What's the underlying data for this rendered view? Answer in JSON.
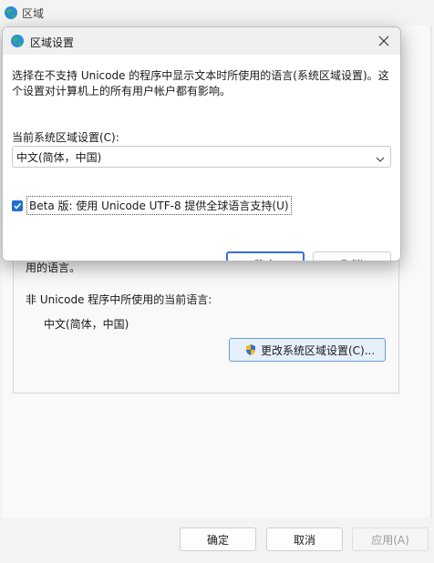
{
  "background_window": {
    "title": "区域",
    "partial_text": "用的语言。",
    "non_unicode_label": "非 Unicode 程序中所使用的当前语言:",
    "current_language": "中文(简体，中国)",
    "change_button": "更改系统区域设置(C)...",
    "footer": {
      "ok": "确定",
      "cancel": "取消",
      "apply": "应用(A)"
    }
  },
  "dialog": {
    "title": "区域设置",
    "description": "选择在不支持 Unicode 的程序中显示文本时所使用的语言(系统区域设置)。这个设置对计算机上的所有用户帐户都有影响。",
    "locale_label": "当前系统区域设置(C):",
    "locale_value": "中文(简体，中国)",
    "beta_label": "Beta 版: 使用 Unicode UTF-8 提供全球语言支持(U)",
    "beta_checked": true,
    "ok": "确定",
    "cancel": "取消"
  },
  "icons": {
    "app": "globe-icon",
    "close": "close-icon",
    "chevron": "chevron-down-icon",
    "shield": "uac-shield-icon",
    "check": "check-icon"
  },
  "colors": {
    "accent": "#1f6fce",
    "dialog_body": "#ffffff",
    "window_bg": "#f3f3f3"
  }
}
